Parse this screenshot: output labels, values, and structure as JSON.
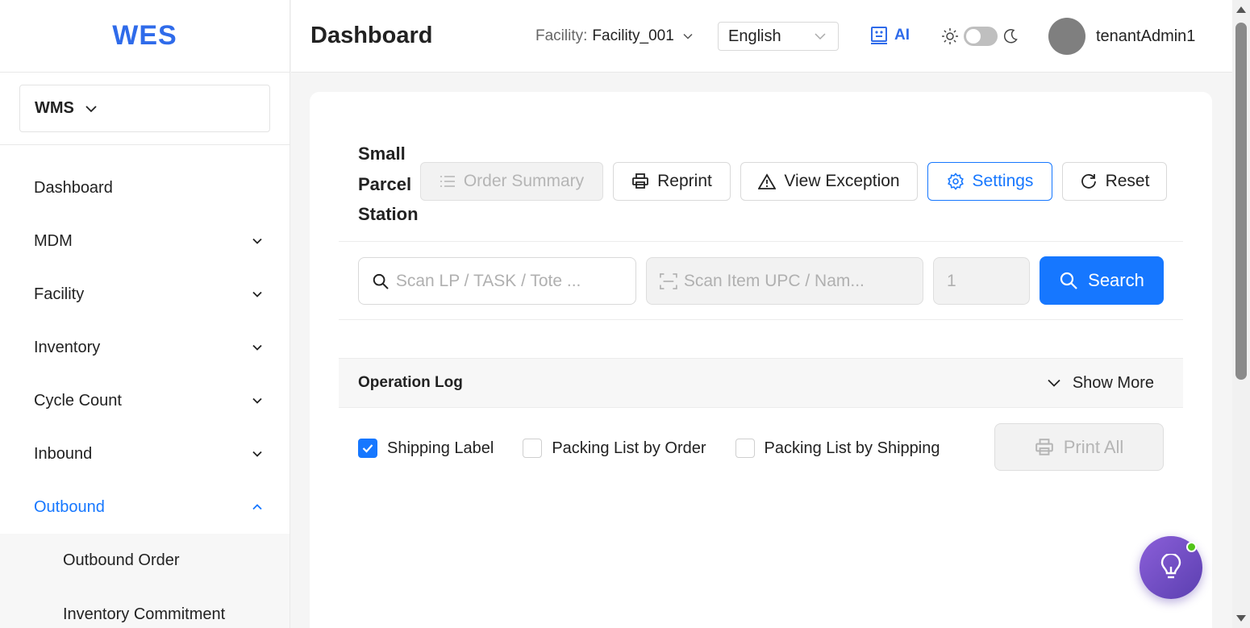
{
  "app": {
    "logo": "WES"
  },
  "sidebar": {
    "module": "WMS",
    "items": [
      {
        "label": "Dashboard",
        "expandable": false
      },
      {
        "label": "MDM",
        "expandable": true
      },
      {
        "label": "Facility",
        "expandable": true
      },
      {
        "label": "Inventory",
        "expandable": true
      },
      {
        "label": "Cycle Count",
        "expandable": true
      },
      {
        "label": "Inbound",
        "expandable": true
      },
      {
        "label": "Outbound",
        "expandable": true,
        "active": true
      }
    ],
    "subitems": [
      {
        "label": "Outbound Order"
      },
      {
        "label": "Inventory Commitment"
      }
    ]
  },
  "header": {
    "title": "Dashboard",
    "facility_label": "Facility:",
    "facility_value": "Facility_001",
    "language": "English",
    "ai_label": "AI",
    "username": "tenantAdmin1"
  },
  "station": {
    "title": "Small Parcel Station",
    "buttons": {
      "order_summary": "Order Summary",
      "reprint": "Reprint",
      "view_exception": "View Exception",
      "settings": "Settings",
      "reset": "Reset"
    },
    "scan_lp_placeholder": "Scan LP / TASK / Tote ...",
    "scan_item_placeholder": "Scan Item UPC / Nam...",
    "qty_placeholder": "1",
    "search_label": "Search"
  },
  "operation_log": {
    "title": "Operation Log",
    "show_more": "Show More"
  },
  "print_options": [
    {
      "label": "Shipping Label",
      "checked": true
    },
    {
      "label": "Packing List by Order",
      "checked": false
    },
    {
      "label": "Packing List by Shipping",
      "checked": false
    }
  ],
  "print_all": "Print All",
  "colors": {
    "accent": "#1677ff",
    "brand": "#2f6bea",
    "fab": "#6b4ac4",
    "online": "#52c41a"
  }
}
